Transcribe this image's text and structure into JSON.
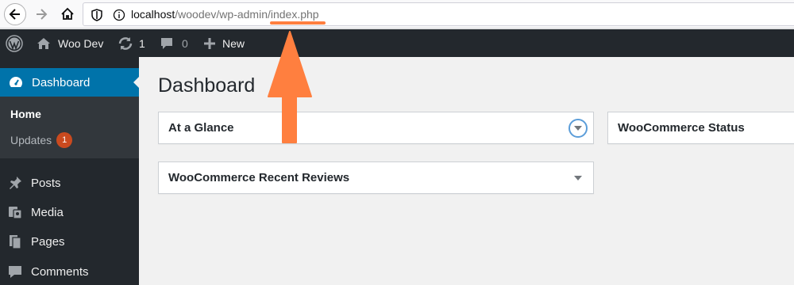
{
  "browser": {
    "url_host": "localhost",
    "url_path": "/woodev/wp-admin/index.php"
  },
  "adminbar": {
    "site_name": "Woo Dev",
    "updates_count": "1",
    "comments_count": "0",
    "new_label": "New"
  },
  "sidebar": {
    "dashboard_label": "Dashboard",
    "submenu": {
      "home_label": "Home",
      "updates_label": "Updates",
      "updates_badge": "1"
    },
    "items": [
      {
        "label": "Posts",
        "icon": "pin-icon"
      },
      {
        "label": "Media",
        "icon": "media-icon"
      },
      {
        "label": "Pages",
        "icon": "pages-icon"
      },
      {
        "label": "Comments",
        "icon": "comments-icon"
      }
    ]
  },
  "main": {
    "page_title": "Dashboard",
    "widgets": {
      "at_a_glance": "At a Glance",
      "woocommerce_status": "WooCommerce Status",
      "recent_reviews": "WooCommerce Recent Reviews"
    }
  },
  "colors": {
    "accent": "#0073aa",
    "adminbar": "#23282d",
    "annotation": "#ff7f3f",
    "badge": "#ca4a1f"
  }
}
